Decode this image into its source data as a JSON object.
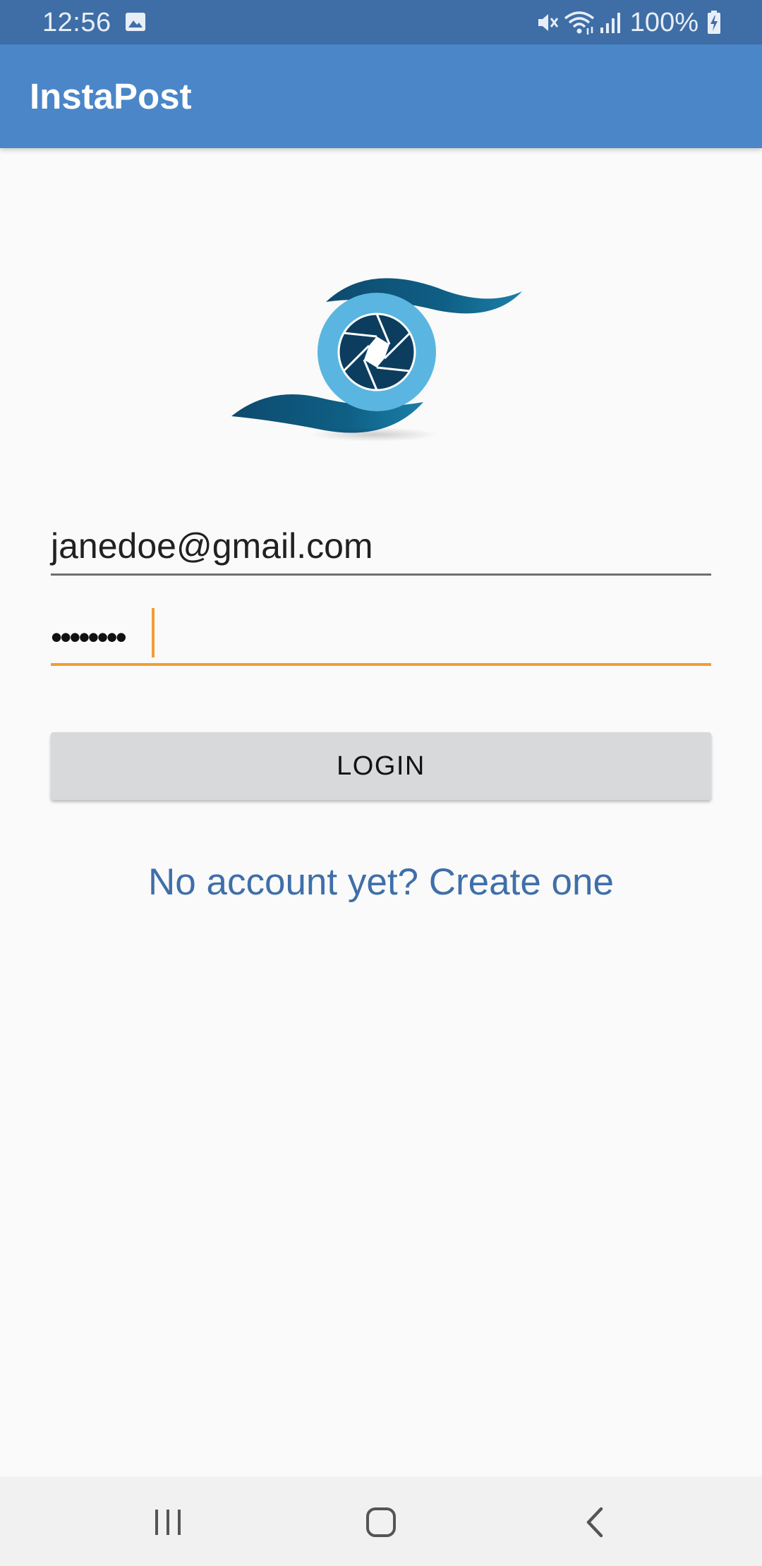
{
  "status_bar": {
    "time": "12:56",
    "battery": "100%",
    "icons": [
      "gallery-icon",
      "mute-icon",
      "wifi-icon",
      "signal-icon",
      "battery-charging-icon"
    ]
  },
  "app_bar": {
    "title": "InstaPost"
  },
  "logo": {
    "icon": "camera-aperture-logo"
  },
  "form": {
    "email_value": "janedoe@gmail.com",
    "password_mask": "••••••••",
    "login_label": "LOGIN",
    "create_account_label": "No account yet? Create one"
  },
  "nav_bar": {
    "icons": [
      "recents-icon",
      "home-icon",
      "back-icon"
    ]
  },
  "colors": {
    "status_bar": "#3f6ea6",
    "app_bar": "#4a86c8",
    "accent": "#ef9f2e",
    "link": "#3f6fa9",
    "button": "#d8d9da"
  }
}
